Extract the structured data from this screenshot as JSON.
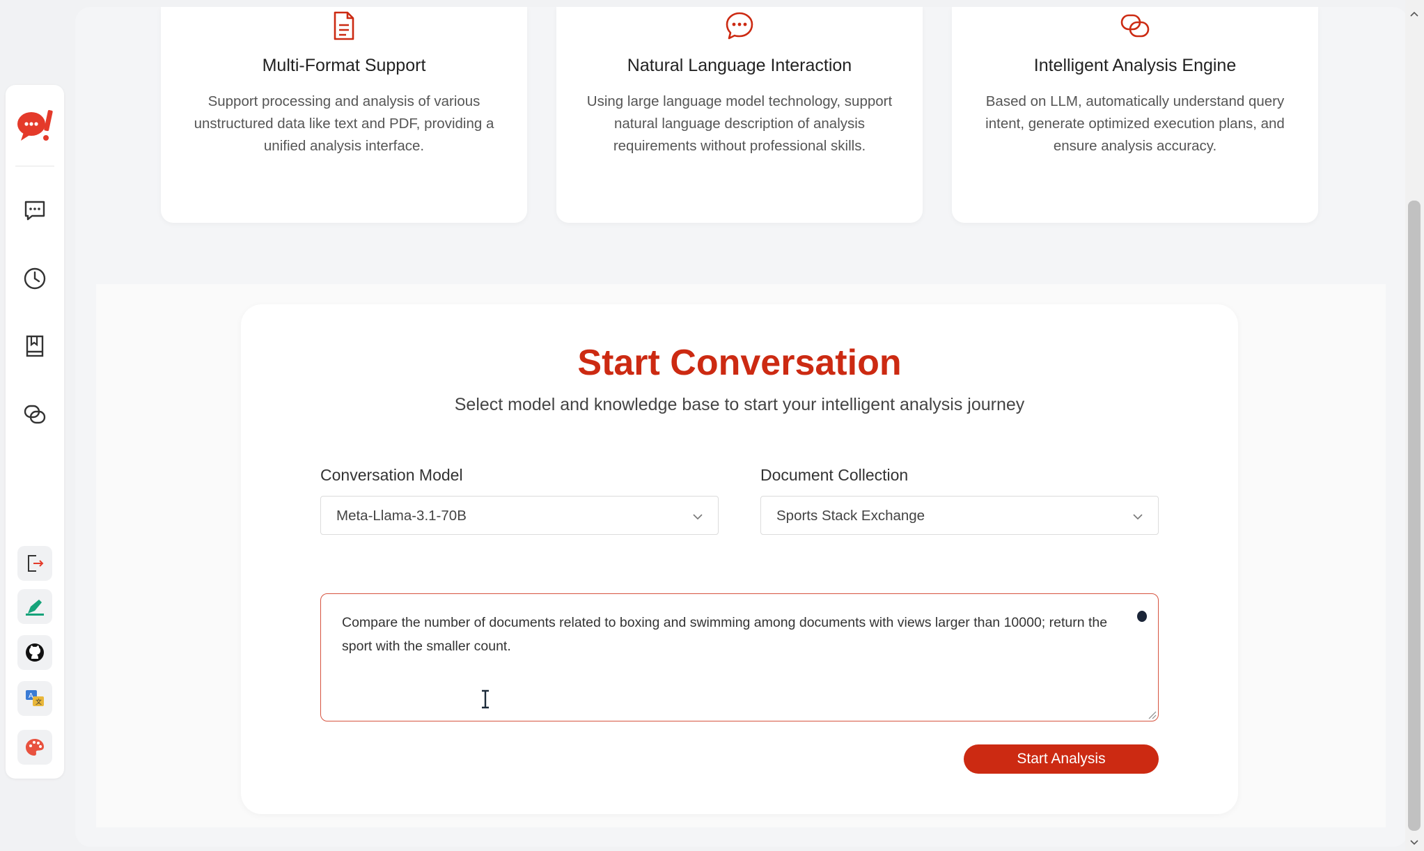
{
  "features": [
    {
      "icon": "document-icon",
      "title": "Multi-Format Support",
      "description": "Support processing and analysis of various unstructured data like text and PDF, providing a unified analysis interface."
    },
    {
      "icon": "chat-bubble-icon",
      "title": "Natural Language Interaction",
      "description": "Using large language model technology, support natural language description of analysis requirements without professional skills."
    },
    {
      "icon": "link-icon",
      "title": "Intelligent Analysis Engine",
      "description": "Based on LLM, automatically understand query intent, generate optimized execution plans, and ensure analysis accuracy."
    }
  ],
  "conversation": {
    "title": "Start Conversation",
    "subtitle": "Select model and knowledge base to start your intelligent analysis journey",
    "model_label": "Conversation Model",
    "model_value": "Meta-Llama-3.1-70B",
    "collection_label": "Document Collection",
    "collection_value": "Sports Stack Exchange",
    "query": "Compare the number of documents related to boxing and swimming among documents with views larger than 10000; return the sport with the smaller count.",
    "submit_label": "Start Analysis"
  },
  "sidebar": {
    "nav_icons": [
      "chat-icon",
      "history-clock-icon",
      "knowledge-book-icon",
      "link-icon"
    ],
    "tool_icons": [
      "logout-icon",
      "edit-theme-icon",
      "github-icon",
      "translate-icon",
      "palette-icon"
    ]
  },
  "colors": {
    "accent": "#cc2a12",
    "query_border": "#d6533f"
  }
}
